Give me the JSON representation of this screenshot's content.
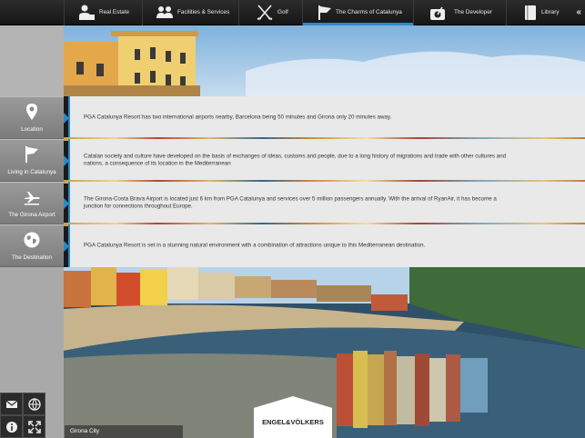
{
  "nav": {
    "items": [
      {
        "label": "Real Estate",
        "icon": "house-person-icon"
      },
      {
        "label": "Facilities & Services",
        "icon": "people-icon"
      },
      {
        "label": "Golf",
        "icon": "golf-clubs-icon"
      },
      {
        "label": "The Charms of Catalunya",
        "icon": "flag-icon",
        "active": true
      },
      {
        "label": "The Developer",
        "icon": "developer-icon"
      },
      {
        "label": "Library",
        "icon": "book-icon"
      }
    ],
    "collapse_label": "«"
  },
  "rows": [
    {
      "label": "Location",
      "icon": "map-pin-icon",
      "text": "PGA Catalunya Resort has two international airports nearby, Barcelona being 50 minutes and Girona only 20 minutes away."
    },
    {
      "label": "Living in Catalunya",
      "icon": "flag-icon",
      "text": "Catalan society and culture have developed on the basis of exchanges of ideas, customs and people, due to a long history of migrations and trade with other cultures and nations, a consequence of its location in the Mediterranean"
    },
    {
      "label": "The Girona Airport",
      "icon": "airplane-icon",
      "text": "The Girona-Costa Brava Airport is located just 6 km from PGA Catalunya and services over 5 million passengers annually. With the arrival of RyanAir, it has become a junction for connections throughout Europe."
    },
    {
      "label": "The Destination",
      "icon": "globe-icon",
      "text": "PGA Catalunya Resort is set in a stunning natural environment with a combination of attractions unique to this Mediterranean destination."
    }
  ],
  "tools": [
    {
      "name": "mail-button",
      "icon": "envelope-icon"
    },
    {
      "name": "globe-button",
      "icon": "globe-icon"
    },
    {
      "name": "info-button",
      "icon": "info-icon"
    },
    {
      "name": "fullscreen-button",
      "icon": "expand-icon"
    }
  ],
  "logo": "ENGEL&VÖLKERS",
  "caption": "Girona City",
  "colors": {
    "accent": "#2a8bc8",
    "rail": "#b9b9b9",
    "panel": "#e9e9e9",
    "topbar": "#1f1f1f"
  }
}
